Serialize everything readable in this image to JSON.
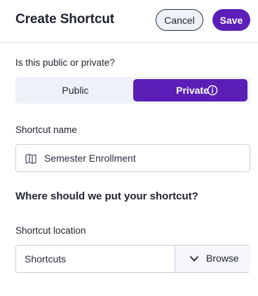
{
  "header": {
    "title": "Create Shortcut",
    "cancel_label": "Cancel",
    "save_label": "Save"
  },
  "visibility": {
    "question": "Is this public or private?",
    "options": [
      {
        "label": "Public",
        "selected": false
      },
      {
        "label": "Private",
        "selected": true,
        "icon": "info-icon"
      }
    ]
  },
  "shortcut_name": {
    "label": "Shortcut name",
    "value": "Semester Enrollment",
    "icon": "book-icon"
  },
  "placement": {
    "heading": "Where should we put your shortcut?",
    "location_label": "Shortcut location",
    "location_value": "Shortcuts",
    "browse_label": "Browse",
    "browse_icon": "chevron-down-icon"
  },
  "colors": {
    "accent": "#5b1fb8",
    "toggle_bg": "#eef2f8",
    "border": "#c9ceda"
  }
}
